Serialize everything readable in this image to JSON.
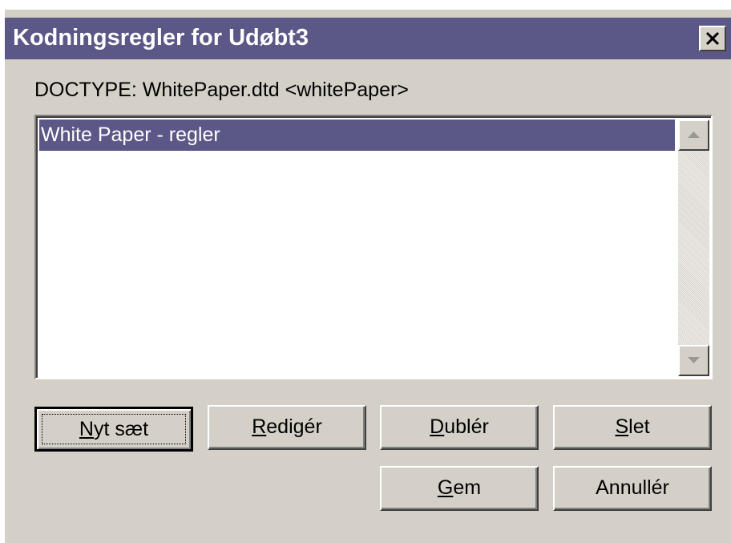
{
  "window": {
    "title": "Kodningsregler for Udøbt3",
    "close_symbol": "✕"
  },
  "doctype_label": "DOCTYPE:  WhitePaper.dtd <whitePaper>",
  "rules_list": {
    "items": [
      {
        "label": "White Paper - regler",
        "selected": true
      }
    ]
  },
  "buttons": {
    "new_set": {
      "mnemonic": "N",
      "rest": "yt sæt"
    },
    "edit": {
      "mnemonic": "R",
      "rest": "edigér"
    },
    "duplicate": {
      "mnemonic": "D",
      "rest": "ublér"
    },
    "delete": {
      "mnemonic": "S",
      "rest": "let"
    },
    "save": {
      "mnemonic": "G",
      "rest": "em"
    },
    "cancel": {
      "label": "Annullér"
    }
  },
  "colors": {
    "titlebar": "#5b5787",
    "selection": "#5b5787",
    "face": "#d4d0c8"
  },
  "icons": {
    "close": "close-icon",
    "scroll_up": "arrow-up-icon",
    "scroll_down": "arrow-down-icon"
  }
}
